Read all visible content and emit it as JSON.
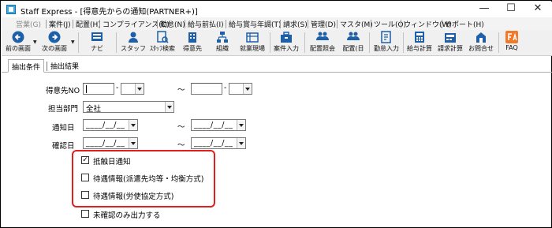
{
  "window": {
    "title": "Staff Express - [得意先からの通知(PARTNER+)]",
    "controls": [
      "minimize",
      "maximize",
      "close"
    ],
    "minimize_glyph": "—",
    "maximize_glyph": "☐",
    "close_glyph": "✕"
  },
  "menu": [
    {
      "label": "営業(G)",
      "enabled": false
    },
    {
      "label": "案件(J)",
      "enabled": true
    },
    {
      "label": "配置(H)",
      "enabled": true
    },
    {
      "label": "コンプライアンス(C)",
      "enabled": true
    },
    {
      "label": "勤怠(N)",
      "enabled": true
    },
    {
      "label": "給与前払(I)",
      "enabled": true
    },
    {
      "label": "給与賞与年調(T)",
      "enabled": true
    },
    {
      "label": "請求(S)",
      "enabled": true
    },
    {
      "label": "管理(D)",
      "enabled": true
    },
    {
      "label": "マスタ(M)",
      "enabled": true
    },
    {
      "label": "ツール(O)",
      "enabled": true
    },
    {
      "label": "ウィンドウ(W)",
      "enabled": true
    },
    {
      "label": "サポート(H)",
      "enabled": true
    }
  ],
  "toolbar": [
    {
      "label": "前の画面",
      "icon": "arrow-left-circle-icon"
    },
    {
      "label": "次の画面",
      "icon": "arrow-right-circle-icon"
    },
    {
      "label": "ナビ",
      "icon": "navi-icon"
    },
    {
      "label": "スタッフ",
      "icon": "staff-icon"
    },
    {
      "label": "ｽﾀｯﾌ検索",
      "icon": "staff-search-icon"
    },
    {
      "label": "得意先",
      "icon": "customer-icon"
    },
    {
      "label": "組織",
      "icon": "organization-icon"
    },
    {
      "label": "就業現場",
      "icon": "workplace-icon"
    },
    {
      "label": "案件入力",
      "icon": "case-entry-icon"
    },
    {
      "label": "配置照会",
      "icon": "assignment-inquiry-icon"
    },
    {
      "label": "配置(日",
      "icon": "assignment-daily-icon"
    },
    {
      "label": "勤怠入力",
      "icon": "attendance-entry-icon"
    },
    {
      "label": "給与計算",
      "icon": "payroll-icon"
    },
    {
      "label": "請求計算",
      "icon": "billing-icon"
    },
    {
      "label": "お問合せ",
      "icon": "inquiry-icon"
    },
    {
      "label": "FAQ",
      "icon": "faq-icon"
    }
  ],
  "colors": {
    "toolbar_icon_blue": "#1d5fa8",
    "faq_orange": "#f07a2a",
    "highlight_red": "#e0201c"
  },
  "tabs": [
    {
      "label": "抽出条件",
      "active": true
    },
    {
      "label": "抽出結果",
      "active": false
    }
  ],
  "form": {
    "customer_no_label": "得意先NO",
    "range_separator": "～",
    "hyphen": "-",
    "department_label": "担当部門",
    "department_value": "全社",
    "notice_date_label": "通知日",
    "confirm_date_label": "確認日",
    "date_placeholder": "____/__/__"
  },
  "checkboxes": [
    {
      "label": "抵触日通知",
      "checked": true,
      "checkmark": "✓"
    },
    {
      "label": "待遇情報(派遣先均等・均衡方式)",
      "checked": false,
      "checkmark": ""
    },
    {
      "label": "待遇情報(労使協定方式)",
      "checked": false,
      "checkmark": ""
    },
    {
      "label": "未確認のみ出力する",
      "checked": false,
      "checkmark": ""
    }
  ]
}
